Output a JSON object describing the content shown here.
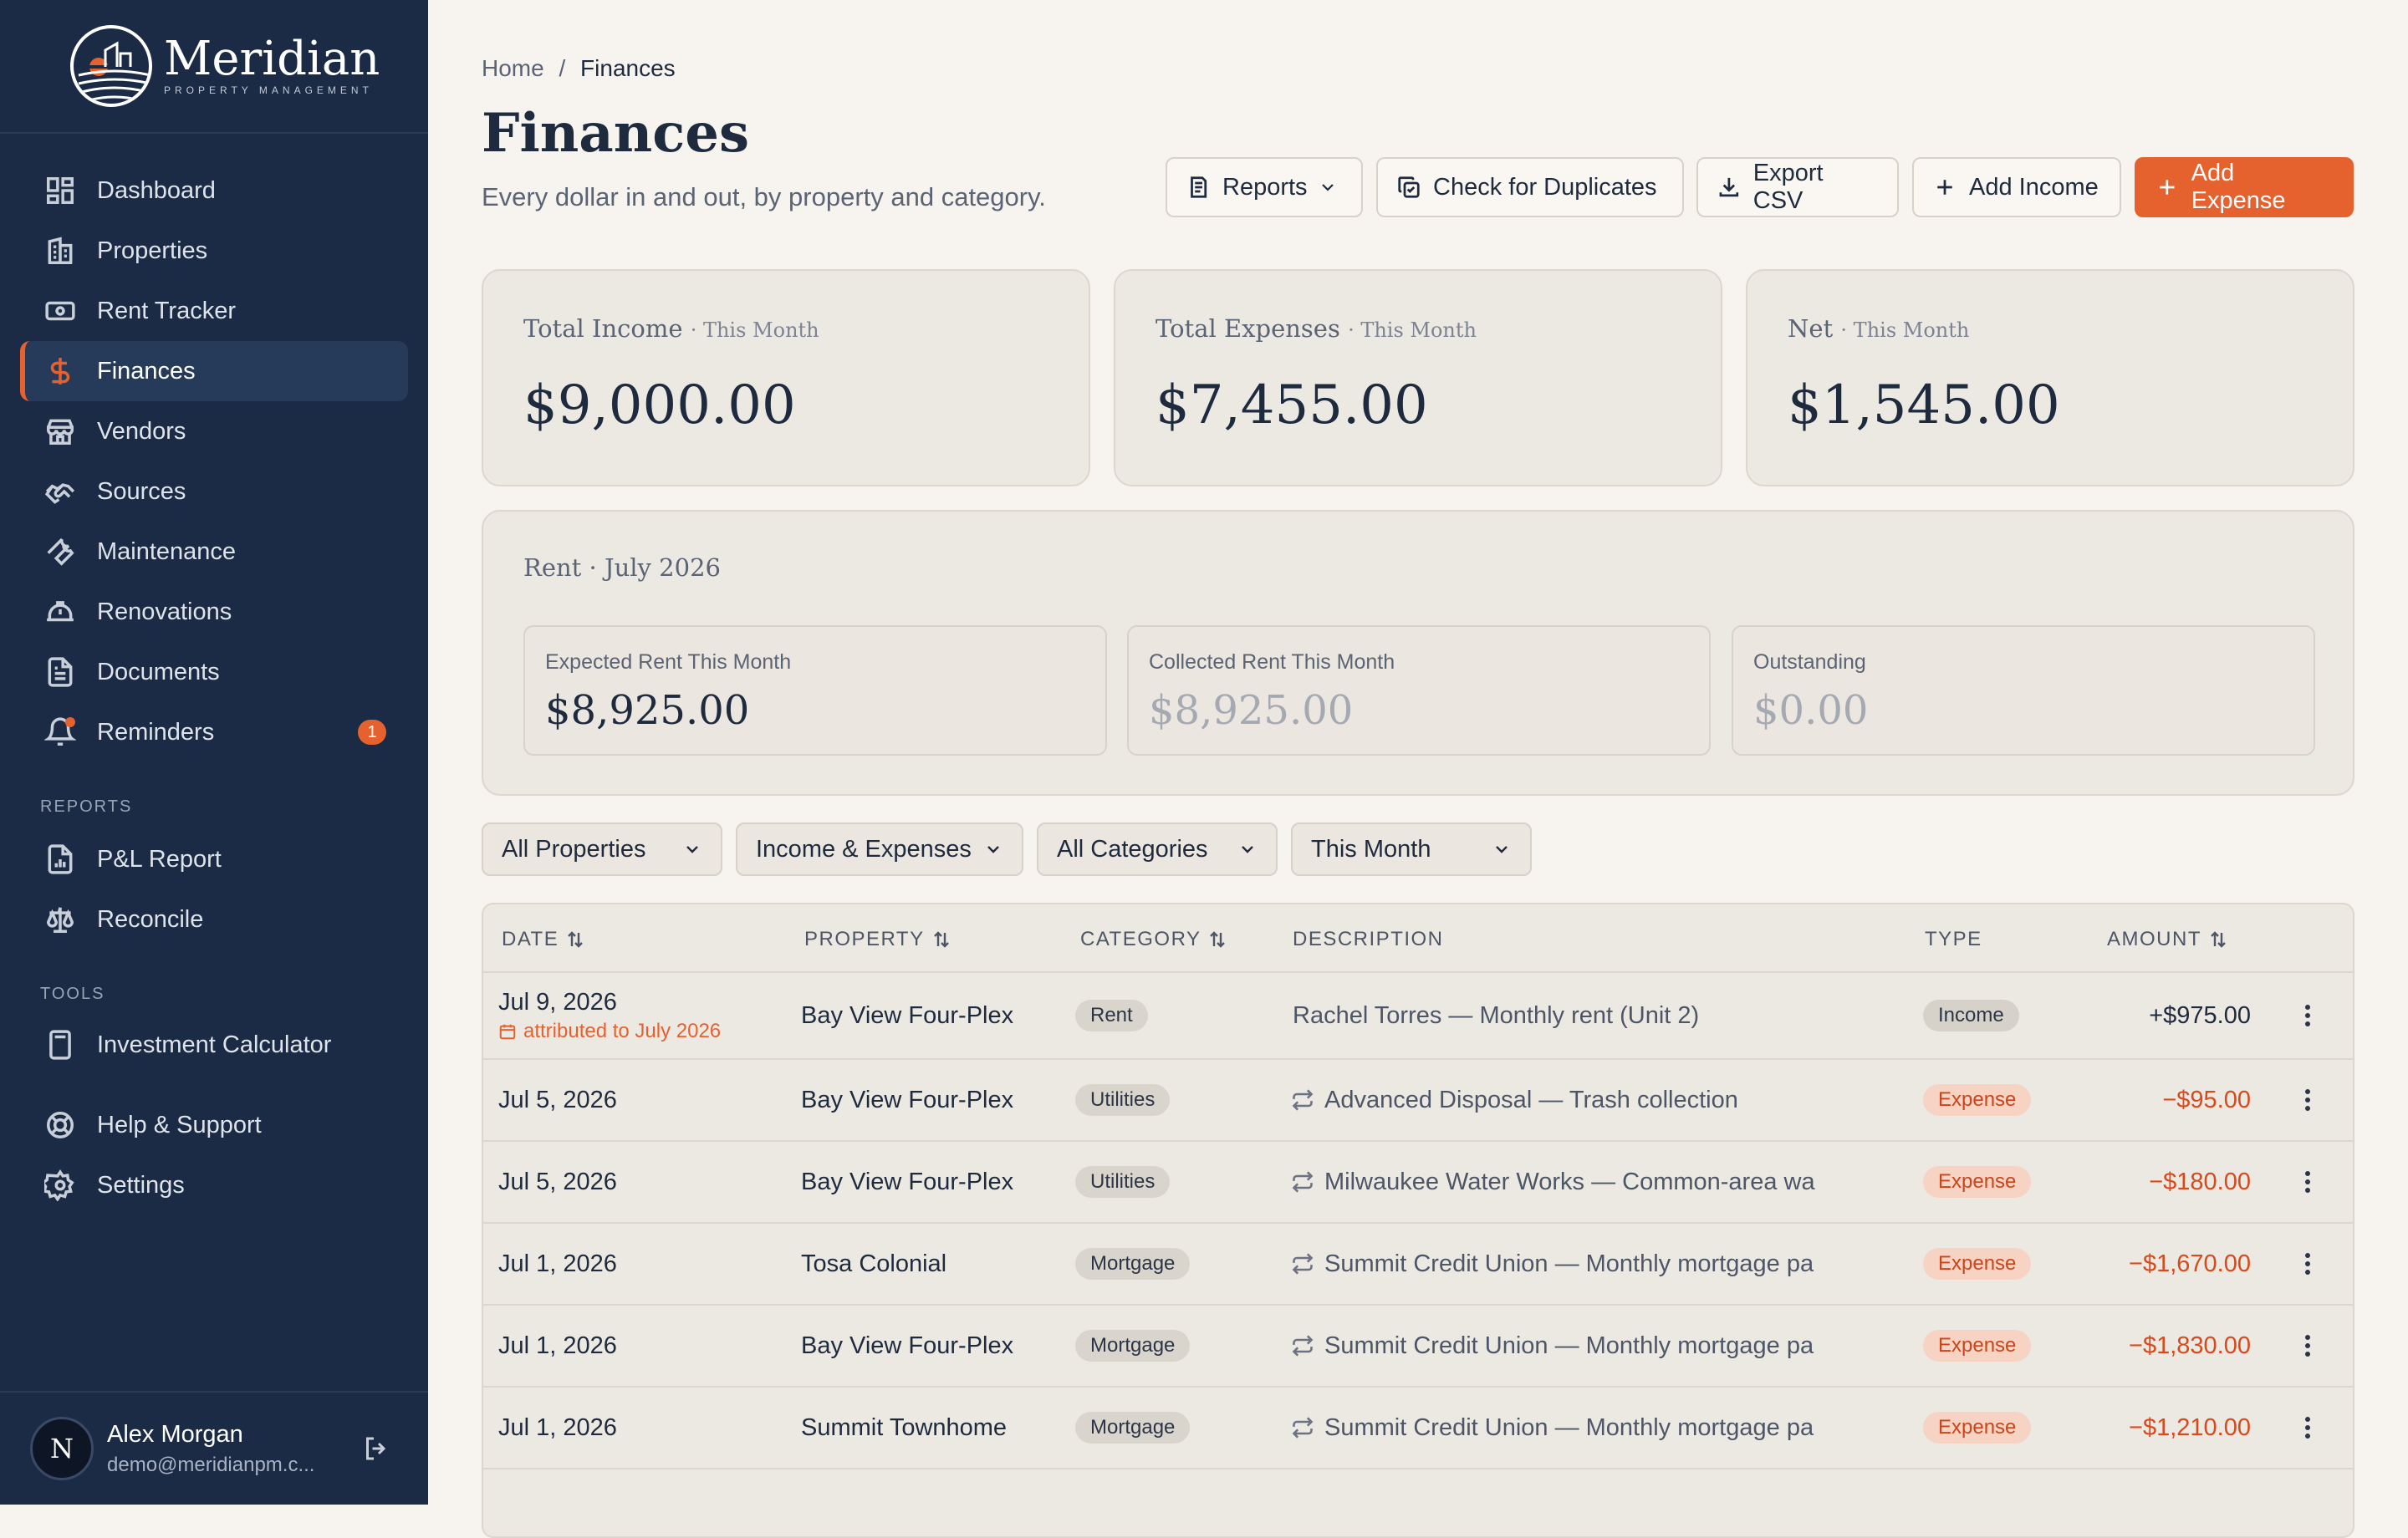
{
  "brand": {
    "name": "Meridian",
    "tagline": "PROPERTY MANAGEMENT"
  },
  "sidebar": {
    "items": [
      {
        "label": "Dashboard",
        "icon": "dashboard-icon"
      },
      {
        "label": "Properties",
        "icon": "building-icon"
      },
      {
        "label": "Rent Tracker",
        "icon": "cash-icon"
      },
      {
        "label": "Finances",
        "icon": "dollar-icon",
        "active": true
      },
      {
        "label": "Vendors",
        "icon": "store-icon"
      },
      {
        "label": "Sources",
        "icon": "handshake-icon"
      },
      {
        "label": "Maintenance",
        "icon": "wrench-icon"
      },
      {
        "label": "Renovations",
        "icon": "hardhat-icon"
      },
      {
        "label": "Documents",
        "icon": "document-icon"
      },
      {
        "label": "Reminders",
        "icon": "bell-icon",
        "badge": "1"
      }
    ],
    "reports_label": "REPORTS",
    "reports": [
      {
        "label": "P&L Report",
        "icon": "report-icon"
      },
      {
        "label": "Reconcile",
        "icon": "scale-icon"
      }
    ],
    "tools_label": "TOOLS",
    "tools": [
      {
        "label": "Investment Calculator",
        "icon": "calculator-icon"
      }
    ],
    "bottom": [
      {
        "label": "Help & Support",
        "icon": "lifebuoy-icon"
      },
      {
        "label": "Settings",
        "icon": "gear-icon"
      }
    ]
  },
  "user": {
    "initial": "N",
    "name": "Alex Morgan",
    "email": "demo@meridianpm.c..."
  },
  "breadcrumb": {
    "home": "Home",
    "separator": "/",
    "current": "Finances"
  },
  "page": {
    "title": "Finances",
    "subtitle": "Every dollar in and out, by property and category."
  },
  "actions": {
    "reports": "Reports",
    "duplicates": "Check for Duplicates",
    "export": "Export CSV",
    "add_income": "Add Income",
    "add_expense": "Add Expense"
  },
  "summary": {
    "income": {
      "label": "Total Income",
      "period": "· This Month",
      "value": "$9,000.00"
    },
    "expenses": {
      "label": "Total Expenses",
      "period": "· This Month",
      "value": "$7,455.00"
    },
    "net": {
      "label": "Net",
      "period": "· This Month",
      "value": "$1,545.00"
    }
  },
  "rent": {
    "title": "Rent · July 2026",
    "expected": {
      "label": "Expected Rent This Month",
      "value": "$8,925.00"
    },
    "collected": {
      "label": "Collected Rent This Month",
      "value": "$8,925.00"
    },
    "outstanding": {
      "label": "Outstanding",
      "value": "$0.00"
    }
  },
  "filters": {
    "property": "All Properties",
    "type": "Income & Expenses",
    "category": "All Categories",
    "period": "This Month"
  },
  "table": {
    "headers": {
      "date": "DATE",
      "property": "PROPERTY",
      "category": "CATEGORY",
      "description": "DESCRIPTION",
      "type": "TYPE",
      "amount": "AMOUNT"
    },
    "rows": [
      {
        "date": "Jul 9, 2026",
        "sub": "attributed to July 2026",
        "property": "Bay View Four-Plex",
        "category": "Rent",
        "description": "Rachel Torres — Monthly rent (Unit 2)",
        "recurring": false,
        "type": "Income",
        "amount": "+$975.00"
      },
      {
        "date": "Jul 5, 2026",
        "property": "Bay View Four-Plex",
        "category": "Utilities",
        "description": "Advanced Disposal — Trash collection",
        "recurring": true,
        "type": "Expense",
        "amount": "−$95.00"
      },
      {
        "date": "Jul 5, 2026",
        "property": "Bay View Four-Plex",
        "category": "Utilities",
        "description": "Milwaukee Water Works — Common-area wa",
        "recurring": true,
        "type": "Expense",
        "amount": "−$180.00"
      },
      {
        "date": "Jul 1, 2026",
        "property": "Tosa Colonial",
        "category": "Mortgage",
        "description": "Summit Credit Union — Monthly mortgage pa",
        "recurring": true,
        "type": "Expense",
        "amount": "−$1,670.00"
      },
      {
        "date": "Jul 1, 2026",
        "property": "Bay View Four-Plex",
        "category": "Mortgage",
        "description": "Summit Credit Union — Monthly mortgage pa",
        "recurring": true,
        "type": "Expense",
        "amount": "−$1,830.00"
      },
      {
        "date": "Jul 1, 2026",
        "property": "Summit Townhome",
        "category": "Mortgage",
        "description": "Summit Credit Union — Monthly mortgage pa",
        "recurring": true,
        "type": "Expense",
        "amount": "−$1,210.00"
      }
    ]
  },
  "colors": {
    "sidebar": "#1b2b45",
    "accent": "#e5622f",
    "background": "#f7f3ee",
    "card": "#ece8e2",
    "negative": "#d84a1b"
  }
}
